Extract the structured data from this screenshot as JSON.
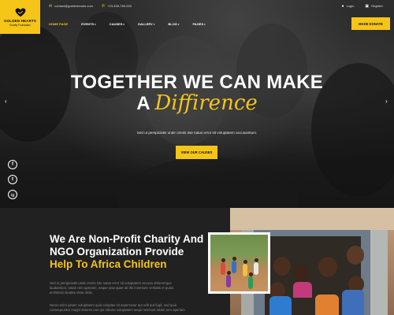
{
  "brand": {
    "title": "GOLDEN HEARTS",
    "subtitle": "Charity Foundation"
  },
  "topbar": {
    "email": "contact@goldenhearts.com",
    "phone": "+23-456-789-000",
    "login": "Login",
    "register": "Register"
  },
  "nav": {
    "items": [
      "HOME PAGE",
      "EVENTS",
      "CAUSES",
      "GALLERY",
      "BLOG",
      "PAGES"
    ],
    "active_index": 0
  },
  "donate_label": "MAKE DONATE",
  "hero": {
    "line1": "TOGETHER WE CAN MAKE",
    "line2_prefix": "A",
    "line2_script": "Diffirence",
    "subtitle": "Sed ut perspiciatis unde omnis iste natus error sit voluptatem accusantium.",
    "cta": "VIEW OUR CAUSES"
  },
  "social": [
    "f",
    "t",
    "ig"
  ],
  "about": {
    "title_line1": "We Are Non-Profit Charity And",
    "title_line2": "NGO Organization Provide",
    "title_line3": "Help To Africa Children",
    "para1_l1": "Sed ut perspiciatis unde omnis iste natus error sit voluptatem accusa doloremque",
    "para1_l2": "laudantium, totam rem aperiam, eaque ipsa quae ab illo inventore veritatis et quasi",
    "para1_l3": "architecto beatae vitae dicta.",
    "para2_l1": "Nemo enim ipsam voluptatem quia voluptas sit aspernatur aut odit aut fugit, sed quia",
    "para2_l2": "consequuntur magni dolores eos qui ratione voluptatem sequi nesciunt totam rem aperiam"
  },
  "colors": {
    "accent": "#f5c518",
    "dark": "#212121"
  }
}
